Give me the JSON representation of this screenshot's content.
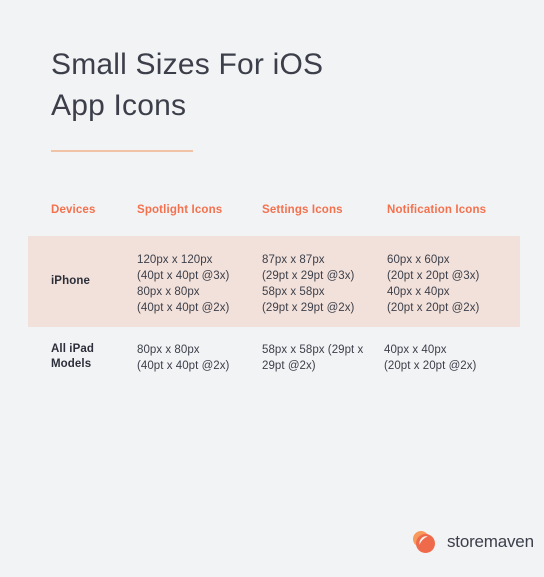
{
  "document": {
    "title_lines": [
      "Small Sizes For iOS",
      "App Icons"
    ]
  },
  "colors": {
    "background": "#f2f3f5",
    "accent": "#f4714e",
    "rule": "#f2c2a6",
    "highlight_row": "#f2e1da",
    "text_dark": "#3c3f4a",
    "logo_orange_light": "#f79a5c",
    "logo_orange_deep": "#ef6a4a"
  },
  "table": {
    "headers": [
      "Devices",
      "Spotlight Icons",
      "Settings Icons",
      "Notification Icons"
    ],
    "rows": [
      {
        "device": "iPhone",
        "device_lines": [
          "iPhone"
        ],
        "highlighted": true,
        "spotlight": [
          "120px x 120px",
          "(40pt x 40pt @3x)",
          "80px x 80px",
          "(40pt x 40pt @2x)"
        ],
        "settings": [
          "87px x 87px",
          "(29pt x 29pt @3x)",
          "58px x 58px",
          "(29pt x 29pt @2x)"
        ],
        "notification": [
          "60px x 60px",
          "(20pt x 20pt @3x)",
          "40px x 40px",
          "(20pt x 20pt @2x)"
        ]
      },
      {
        "device": "All iPad Models",
        "device_lines": [
          "All iPad",
          "Models"
        ],
        "highlighted": false,
        "spotlight": [
          "80px x 80px",
          "(40pt x 40pt @2x)"
        ],
        "settings_text": "58px x 58px (29pt x 29pt @2x)",
        "notification": [
          "40px x 40px",
          "(20pt x 20pt @2x)"
        ]
      }
    ]
  },
  "footer": {
    "brand": "storemaven",
    "logo_icon": "storemaven-logo-icon"
  }
}
